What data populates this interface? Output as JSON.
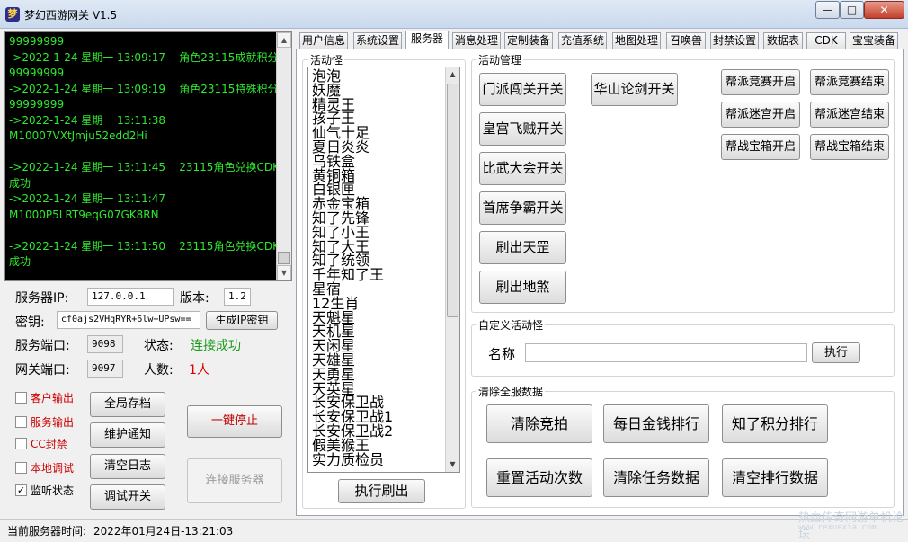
{
  "window": {
    "title": "梦幻西游网关 V1.5",
    "icon": "app-logo-icon",
    "controls": {
      "minimize": "—",
      "maximize": "□",
      "close": "✕"
    }
  },
  "log": {
    "lines": [
      "99999999",
      "->2022-1-24 星期一 13:09:17    角色23115成就积分",
      "99999999",
      "->2022-1-24 星期一 13:09:19    角色23115特殊积分",
      "99999999",
      "->2022-1-24 星期一 13:11:38",
      "M10007VXtJmju52edd2Hi",
      "",
      "->2022-1-24 星期一 13:11:45    23115角色兑换CDK",
      "成功",
      "->2022-1-24 星期一 13:11:47",
      "M1000P5LRT9eqG07GK8RN",
      "",
      "->2022-1-24 星期一 13:11:50    23115角色兑换CDK",
      "成功"
    ]
  },
  "server": {
    "ip_label": "服务器IP:",
    "ip_value": "127.0.0.1",
    "version_label": "版本:",
    "version_value": "1.2",
    "key_label": "密钥:",
    "key_value": "cf0ajs2VHqRYR+6lw+UPsw==",
    "gen_key_button": "生成IP密钥",
    "service_port_label": "服务端口:",
    "service_port_value": "9098",
    "status_label": "状态:",
    "status_value": "连接成功",
    "gateway_port_label": "网关端口:",
    "gateway_port_value": "9097",
    "people_label": "人数:",
    "people_value": "1人"
  },
  "checkboxes": [
    {
      "label": "客户输出",
      "checked": false
    },
    {
      "label": "服务输出",
      "checked": false
    },
    {
      "label": "CC封禁",
      "checked": false
    },
    {
      "label": "本地调试",
      "checked": false
    },
    {
      "label": "监听状态",
      "checked": true
    }
  ],
  "left_buttons": {
    "save_all": "全局存档",
    "maintenance": "维护通知",
    "clear_log": "清空日志",
    "debug_toggle": "调试开关",
    "one_key_stop": "一键停止",
    "connect_server": "连接服务器"
  },
  "tabs": [
    "用户信息",
    "系统设置",
    "服务器",
    "消息处理",
    "定制装备",
    "充值系统",
    "地图处理",
    "召唤兽",
    "封禁设置",
    "数据表",
    "CDK",
    "宝宝装备"
  ],
  "active_tab": "服务器",
  "monster_panel": {
    "title": "活动怪",
    "items": [
      "泡泡",
      "妖魔",
      "精灵王",
      "孩子王",
      "仙气十足",
      "夏日炎炎",
      "乌铁盒",
      "黄铜箱",
      "白银匣",
      "赤金宝箱",
      "知了先锋",
      "知了小王",
      "知了大王",
      "知了统领",
      "千年知了王",
      "星宿",
      "12生肖",
      "天魁星",
      "天机星",
      "天闲星",
      "天雄星",
      "天勇星",
      "天英星",
      "长安保卫战",
      "长安保卫战1",
      "长安保卫战2",
      "假美猴王",
      "实力质检员"
    ],
    "execute_refresh": "执行刷出"
  },
  "activity": {
    "title": "活动管理",
    "left_buttons": [
      "门派闯关开关",
      "皇宫飞贼开关",
      "比武大会开关",
      "首席争霸开关",
      "刷出天罡",
      "刷出地煞"
    ],
    "huashan": "华山论剑开关",
    "guild_buttons": [
      "帮派竞赛开启",
      "帮派竞赛结束",
      "帮派迷宫开启",
      "帮派迷宫结束",
      "帮战宝箱开启",
      "帮战宝箱结束"
    ]
  },
  "custom_monster": {
    "title": "自定义活动怪",
    "name_label": "名称",
    "name_value": "",
    "execute": "执行"
  },
  "clear_data": {
    "title": "清除全服数据",
    "buttons": [
      "清除竞拍",
      "每日金钱排行",
      "知了积分排行",
      "重置活动次数",
      "清除任务数据",
      "清空排行数据"
    ]
  },
  "statusbar": {
    "label": "当前服务器时间:",
    "time": "2022年01月24日-13:21:03"
  },
  "watermark": {
    "text": "热血传奇网游单机论坛",
    "sub": "www.rexuexia.com"
  },
  "colors": {
    "log_bg": "#000000",
    "log_text": "#2ee82e",
    "status_ok": "#1a9a1a",
    "people_red": "#dd0000",
    "checkbox_label_red": "#cc0000"
  }
}
